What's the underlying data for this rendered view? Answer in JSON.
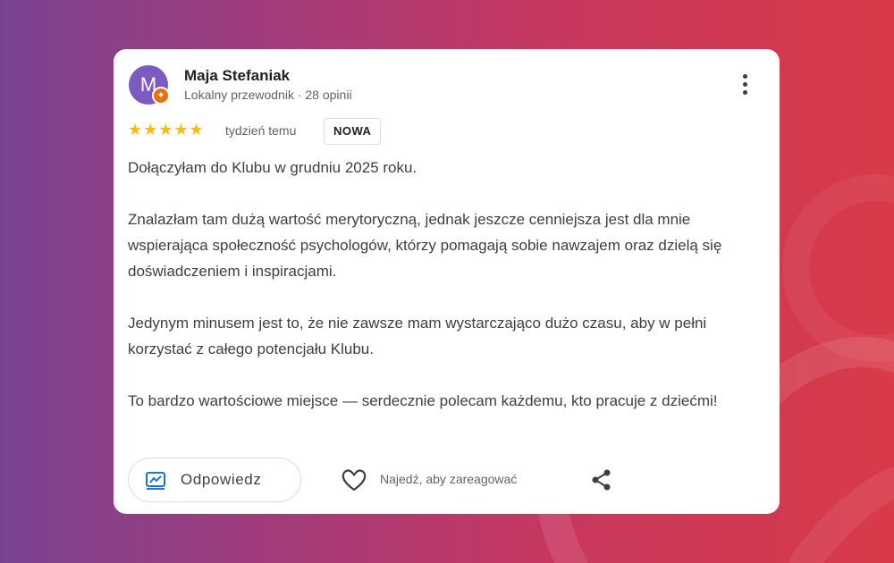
{
  "colors": {
    "background_left": "#7a4391",
    "background_right": "#d83a48",
    "card": "#ffffff",
    "avatar": "#7b5bc2",
    "badge": "#e8710a",
    "stars": "#fbbc04",
    "reply_icon": "#1a73e8"
  },
  "review": {
    "author": {
      "initial": "M",
      "name": "Maja Stefaniak",
      "subtitle": "Lokalny przewodnik · 28 opinii",
      "badge_icon": "local-guide-star-icon"
    },
    "rating": {
      "value": 5,
      "max": 5,
      "stars": "★★★★★"
    },
    "time": "tydzień temu",
    "tag": "NOWA",
    "paragraphs": [
      "Dołączyłam do Klubu w grudniu 2025 roku.",
      "Znalazłam tam dużą wartość merytoryczną, jednak jeszcze cenniejsza jest dla mnie wspierająca społeczność psychologów, którzy pomagają sobie nawzajem oraz dzielą się doświadczeniem i inspiracjami.",
      "Jedynym minusem jest to, że nie zawsze mam wystarczająco dużo czasu, aby w pełni korzystać z całego potencjału Klubu.",
      "To bardzo wartościowe miejsce — serdecznie polecam każdemu, kto pracuje z dziećmi!"
    ]
  },
  "actions": {
    "reply_label": "Odpowiedz",
    "reply_icon": "reply-icon",
    "react_hint": "Najedź, aby zareagować",
    "react_icon": "heart-icon",
    "share_icon": "share-icon",
    "menu_icon": "more-vert-icon"
  }
}
